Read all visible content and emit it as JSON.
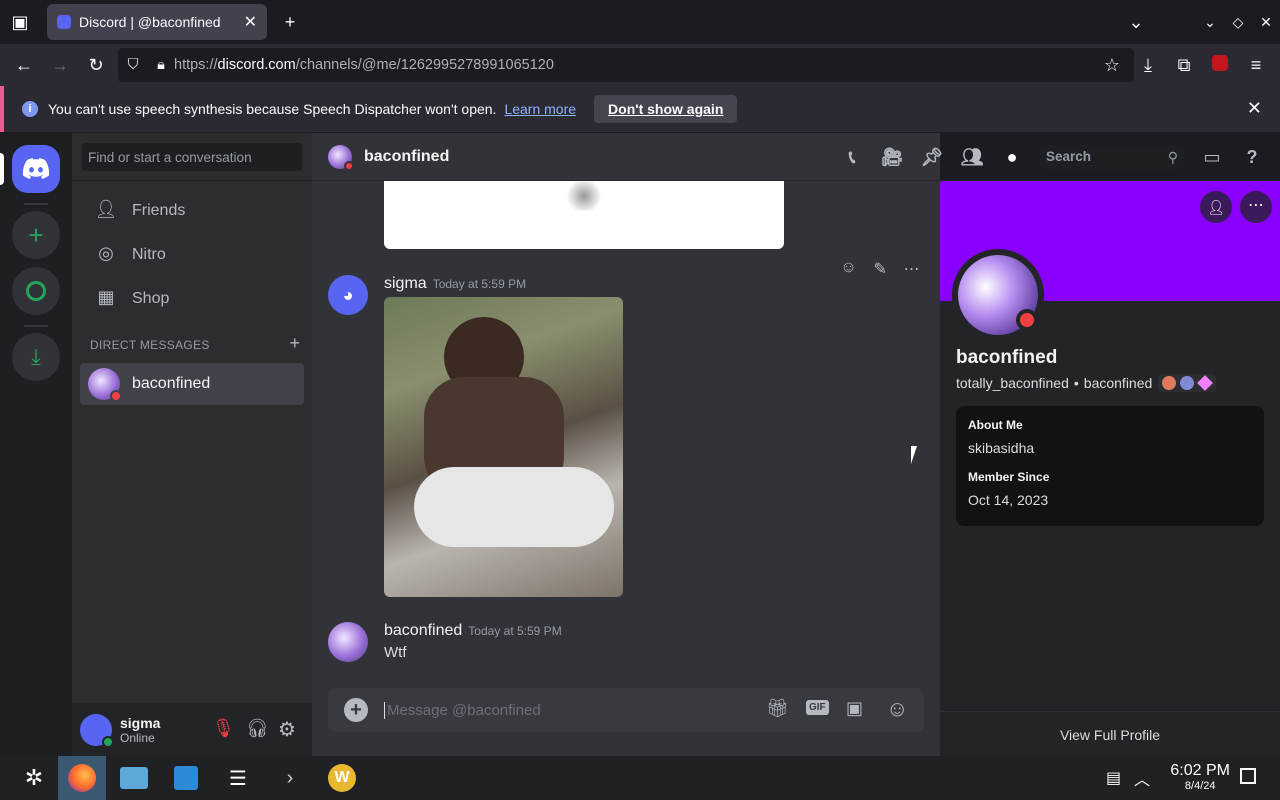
{
  "browser": {
    "tab_title": "Discord | @baconfined",
    "url_prefix": "https://",
    "url_domain": "discord.com",
    "url_path": "/channels/@me/1262995278991065120"
  },
  "notification": {
    "message": "You can't use speech synthesis because Speech Dispatcher won't open.",
    "learn_more": "Learn more",
    "dont_show": "Don't show again"
  },
  "dm_sidebar": {
    "search_placeholder": "Find or start a conversation",
    "nav": [
      {
        "label": "Friends"
      },
      {
        "label": "Nitro"
      },
      {
        "label": "Shop"
      }
    ],
    "dm_header": "DIRECT MESSAGES",
    "dm_user": "baconfined"
  },
  "user": {
    "name": "sigma",
    "status": "Online"
  },
  "chat": {
    "header_name": "baconfined",
    "search": "Search",
    "messages": [
      {
        "author": "sigma",
        "time": "Today at 5:59 PM",
        "text": ""
      },
      {
        "author": "baconfined",
        "time": "Today at 5:59 PM",
        "text": "Wtf"
      }
    ],
    "composer_placeholder": "Message @baconfined"
  },
  "profile": {
    "display_name": "baconfined",
    "username": "totally_baconfined",
    "separator": "•",
    "pronoun": "baconfined",
    "about_label": "About Me",
    "about_text": "skibasidha",
    "member_label": "Member Since",
    "member_date": "Oct 14, 2023",
    "view_full": "View Full Profile"
  },
  "taskbar": {
    "time": "6:02 PM",
    "date": "8/4/24"
  },
  "colors": {
    "accent": "#5865f2",
    "banner": "#8a00ff",
    "dnd": "#f23f43",
    "online": "#23a55a"
  }
}
